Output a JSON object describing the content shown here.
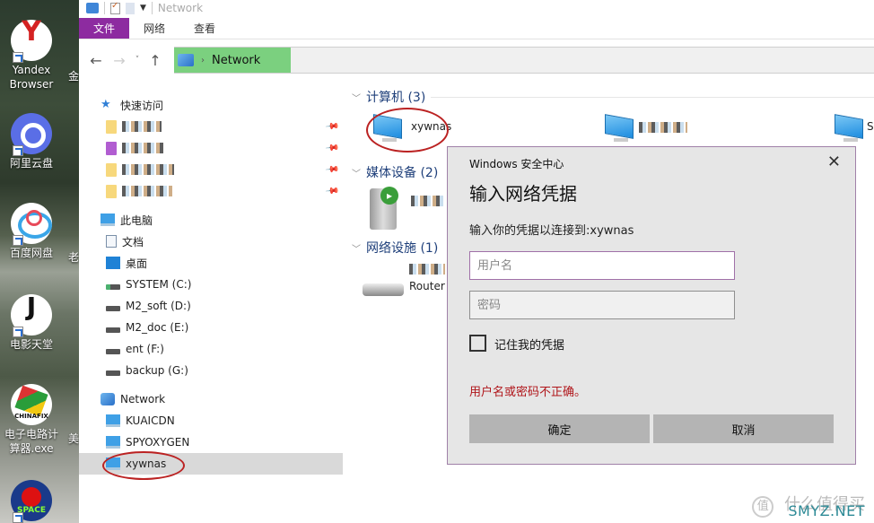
{
  "desktop": {
    "icons": [
      {
        "label": "Yandex Browser",
        "icon": "yandex-icon"
      },
      {
        "label": "阿里云盘",
        "icon": "aliyun-drive-icon"
      },
      {
        "label": "百度网盘",
        "icon": "baidu-netdisk-icon"
      },
      {
        "label": "电影天堂",
        "icon": "movie-app-icon"
      },
      {
        "label": "电子电路计算器.exe",
        "icon": "chinafix-icon"
      },
      {
        "label": "",
        "icon": "angry-birds-space-icon"
      }
    ],
    "partial_labels": [
      "金",
      "老",
      "美"
    ]
  },
  "window": {
    "title": "Network",
    "ribbon_tabs": [
      {
        "label": "文件",
        "active": true
      },
      {
        "label": "网络"
      },
      {
        "label": "查看"
      }
    ],
    "nav": {
      "back": "←",
      "forward": "→",
      "recent": "˅",
      "up": "↑"
    },
    "address": {
      "crumb": "Network",
      "separator": "›"
    }
  },
  "sidebar": {
    "quick_access": {
      "label": "快速访问",
      "items": [
        {
          "label": "(redacted).0",
          "pinned": true
        },
        {
          "label": "(redacted)",
          "pinned": true
        },
        {
          "label": "(redacted)",
          "pinned": true
        },
        {
          "label": "do(redacted)",
          "pinned": true
        }
      ]
    },
    "this_pc": {
      "label": "此电脑",
      "items": [
        {
          "label": "文档",
          "icon": "documents-icon"
        },
        {
          "label": "桌面",
          "icon": "desktop-folder-icon"
        },
        {
          "label": "SYSTEM (C:)",
          "icon": "system-drive-icon"
        },
        {
          "label": "M2_soft (D:)",
          "icon": "drive-icon"
        },
        {
          "label": "M2_doc (E:)",
          "icon": "drive-icon"
        },
        {
          "label": "ent (F:)",
          "icon": "drive-icon"
        },
        {
          "label": "backup (G:)",
          "icon": "drive-icon"
        }
      ]
    },
    "network": {
      "label": "Network",
      "items": [
        {
          "label": "KUAICDN"
        },
        {
          "label": "SPYOXYGEN"
        },
        {
          "label": "xywnas",
          "selected": true
        }
      ]
    }
  },
  "content": {
    "groups": [
      {
        "label": "计算机 (3)",
        "items": [
          {
            "label": "xywnas"
          },
          {
            "label": "(redacted)"
          },
          {
            "label": "S"
          }
        ]
      },
      {
        "label": "媒体设备 (2)",
        "items": [
          {
            "label": "(redacted)"
          }
        ]
      },
      {
        "label": "网络设施 (1)",
        "items": [
          {
            "label": "(redacted) Router"
          }
        ]
      }
    ]
  },
  "dialog": {
    "title": "Windows 安全中心",
    "close": "✕",
    "heading": "输入网络凭据",
    "subtitle": "输入你的凭据以连接到:xywnas",
    "username_placeholder": "用户名",
    "username_value": "",
    "password_placeholder": "密码",
    "password_value": "",
    "remember_label": "记住我的凭据",
    "remember_checked": false,
    "error": "用户名或密码不正确。",
    "ok_label": "确定",
    "cancel_label": "取消"
  },
  "watermark": {
    "logo": "值",
    "text": "什么值得买",
    "site": "SMYZ.NET"
  }
}
